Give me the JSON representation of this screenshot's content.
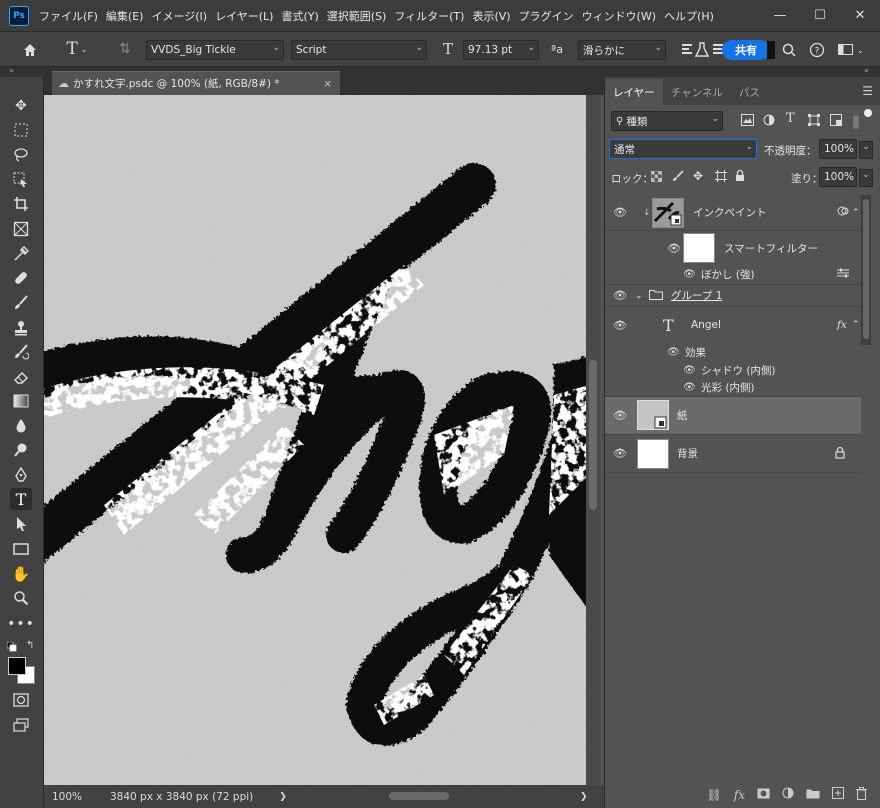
{
  "app": {
    "logo": "Ps"
  },
  "menu": [
    "ファイル(F)",
    "編集(E)",
    "イメージ(I)",
    "レイヤー(L)",
    "書式(Y)",
    "選択範囲(S)",
    "フィルター(T)",
    "表示(V)",
    "プラグイン",
    "ウィンドウ(W)",
    "ヘルプ(H)"
  ],
  "window": {
    "minimize": "—",
    "maximize": "☐",
    "close": "✕"
  },
  "options": {
    "font_family": "VVDS_Big Tickle",
    "font_style": "Script",
    "font_size": "97.13 pt",
    "aa_label": "ªa",
    "antialias": "滑らかに",
    "share": "共有"
  },
  "document": {
    "tab_title": "かすれ文字.psdc @ 100% (紙, RGB/8#) *",
    "zoom": "100%",
    "doc_size": "3840 px x 3840 px (72 ppi)",
    "status_arrow": "❯"
  },
  "panel": {
    "tabs": [
      "レイヤー",
      "チャンネル",
      "パス"
    ],
    "filter_kind": "種類",
    "blend_mode": "通常",
    "opacity_label": "不透明度：",
    "opacity_value": "100%",
    "lock_label": "ロック：",
    "fill_label": "塗り：",
    "fill_value": "100%"
  },
  "layers": {
    "inpaint": "インクペイント",
    "smart_filter": "スマートフィルター",
    "blur": "ぼかし (強)",
    "group": "グループ 1",
    "angel": "Angel",
    "fx": "fx",
    "effects": "効果",
    "shadow": "シャドウ (内側)",
    "glow": "光彩 (内側)",
    "paper": "紙",
    "background": "背景"
  },
  "colors": {
    "accent": "#1473e6",
    "canvas": "#c3c5c2",
    "ink": "#0a0a0a"
  }
}
